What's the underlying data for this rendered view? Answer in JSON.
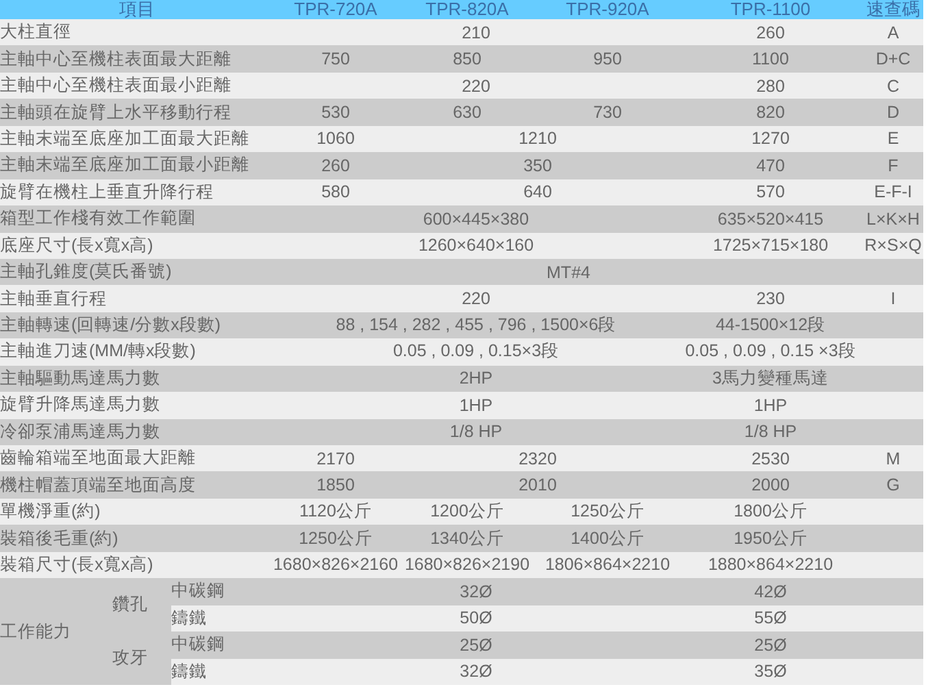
{
  "header": {
    "item": "項目",
    "models": [
      "TPR-720A",
      "TPR-820A",
      "TPR-920A",
      "TPR-1100"
    ],
    "code": "速查碼"
  },
  "rows": [
    {
      "label": "大柱直徑",
      "values": [
        {
          "text": "210"
        },
        {
          "merged": true
        },
        {
          "merged": true
        },
        {
          "text": "260"
        }
      ],
      "code": "A"
    },
    {
      "label": "主軸中心至機柱表面最大距離",
      "values": [
        {
          "text": "750"
        },
        {
          "text": "850"
        },
        {
          "text": "950"
        },
        {
          "text": "1100"
        }
      ],
      "code": "D+C"
    },
    {
      "label": "主軸中心至機柱表面最小距離",
      "values": [
        {
          "text": "220"
        },
        {
          "merged": true
        },
        {
          "merged": true
        },
        {
          "text": "280"
        }
      ],
      "code": "C"
    },
    {
      "label": "主軸頭在旋臂上水平移動行程",
      "values": [
        {
          "text": "530"
        },
        {
          "text": "630"
        },
        {
          "text": "730"
        },
        {
          "text": "820"
        }
      ],
      "code": "D"
    },
    {
      "label": "主軸末端至底座加工面最大距離",
      "values": [
        {
          "text": "1060"
        },
        {
          "text": "1210"
        },
        {
          "merged": true
        },
        {
          "text": "1270"
        }
      ],
      "code": "E"
    },
    {
      "label": "主軸末端至底座加工面最小距離",
      "values": [
        {
          "text": "260"
        },
        {
          "text": "350"
        },
        {
          "merged": true
        },
        {
          "text": "470"
        }
      ],
      "code": "F"
    },
    {
      "label": "旋臂在機柱上垂直升降行程",
      "values": [
        {
          "text": "580"
        },
        {
          "text": "640"
        },
        {
          "merged": true
        },
        {
          "text": "570"
        }
      ],
      "code": "E-F-I"
    },
    {
      "label": "箱型工作棧有效工作範圍",
      "values": [
        {
          "text": "600×445×380"
        },
        {
          "merged": true
        },
        {
          "merged": true
        },
        {
          "text": "635×520×415"
        }
      ],
      "code": "L×K×H"
    },
    {
      "label": "底座尺寸(長x寬x高)",
      "values": [
        {
          "text": "1260×640×160"
        },
        {
          "merged": true
        },
        {
          "merged": true
        },
        {
          "text": "1725×715×180"
        }
      ],
      "code": "R×S×Q"
    },
    {
      "label": "主軸孔錐度(莫氏番號)",
      "values": [
        {
          "text": "MT#4"
        },
        {
          "merged": true
        },
        {
          "merged": true
        },
        {
          "merged": true
        }
      ]
    },
    {
      "label": "主軸垂直行程",
      "values": [
        {
          "text": "220"
        },
        {
          "merged": true
        },
        {
          "merged": true
        },
        {
          "text": "230"
        }
      ],
      "code": "I"
    },
    {
      "label": "主軸轉速(回轉速/分數x段數)",
      "values": [
        {
          "text": "88 , 154 , 282 , 455 , 796 , 1500×6段"
        },
        {
          "merged": true
        },
        {
          "merged": true
        },
        {
          "text": "44-1500×12段"
        }
      ]
    },
    {
      "label": "主軸進刀速(MM/轉x段數)",
      "values": [
        {
          "text": "0.05 , 0.09 , 0.15×3段"
        },
        {
          "merged": true
        },
        {
          "merged": true
        },
        {
          "text": "0.05 , 0.09 , 0.15 ×3段"
        }
      ]
    },
    {
      "label": "主軸驅動馬達馬力數",
      "values": [
        {
          "text": "2HP"
        },
        {
          "merged": true
        },
        {
          "merged": true
        },
        {
          "text": "3馬力變種馬達"
        }
      ]
    },
    {
      "label": "旋臂升降馬達馬力數",
      "values": [
        {
          "text": "1HP"
        },
        {
          "merged": true
        },
        {
          "merged": true
        },
        {
          "text": "1HP"
        }
      ]
    },
    {
      "label": "冷卻泵浦馬達馬力數",
      "values": [
        {
          "text": "1/8 HP"
        },
        {
          "merged": true
        },
        {
          "merged": true
        },
        {
          "text": "1/8 HP"
        }
      ]
    },
    {
      "label": "齒輪箱端至地面最大距離",
      "values": [
        {
          "text": "2170"
        },
        {
          "text": "2320"
        },
        {
          "merged": true
        },
        {
          "text": "2530"
        }
      ],
      "code": "M"
    },
    {
      "label": "機柱帽蓋頂端至地面高度",
      "values": [
        {
          "text": "1850"
        },
        {
          "text": "2010"
        },
        {
          "merged": true
        },
        {
          "text": "2000"
        }
      ],
      "code": "G"
    },
    {
      "label": "單機淨重(約)",
      "values": [
        {
          "text": "1120公斤"
        },
        {
          "text": "1200公斤"
        },
        {
          "text": "1250公斤"
        },
        {
          "text": "1800公斤"
        }
      ]
    },
    {
      "label": "裝箱後毛重(約)",
      "values": [
        {
          "text": "1250公斤"
        },
        {
          "text": "1340公斤"
        },
        {
          "text": "1400公斤"
        },
        {
          "text": "1950公斤"
        }
      ]
    },
    {
      "label": "裝箱尺寸(長x寬x高)",
      "values": [
        {
          "text": "1680×826×2160"
        },
        {
          "text": "1680×826×2190"
        },
        {
          "text": "1806×864×2210"
        },
        {
          "text": "1880×864×2210"
        }
      ]
    }
  ],
  "capability": {
    "label": "工作能力",
    "groups": [
      {
        "label": "鑽孔",
        "rows": [
          {
            "material": "中碳鋼",
            "values": [
              {
                "text": "32Ø"
              },
              {
                "merged": true
              },
              {
                "merged": true
              },
              {
                "text": "42Ø"
              }
            ]
          },
          {
            "material": "鑄鐵",
            "values": [
              {
                "text": "50Ø"
              },
              {
                "merged": true
              },
              {
                "merged": true
              },
              {
                "text": "55Ø"
              }
            ]
          }
        ]
      },
      {
        "label": "攻牙",
        "rows": [
          {
            "material": "中碳鋼",
            "values": [
              {
                "text": "25Ø"
              },
              {
                "merged": true
              },
              {
                "merged": true
              },
              {
                "text": "25Ø"
              }
            ]
          },
          {
            "material": "鑄鐵",
            "values": [
              {
                "text": "32Ø"
              },
              {
                "merged": true
              },
              {
                "merged": true
              },
              {
                "text": "35Ø"
              }
            ]
          }
        ]
      }
    ]
  }
}
